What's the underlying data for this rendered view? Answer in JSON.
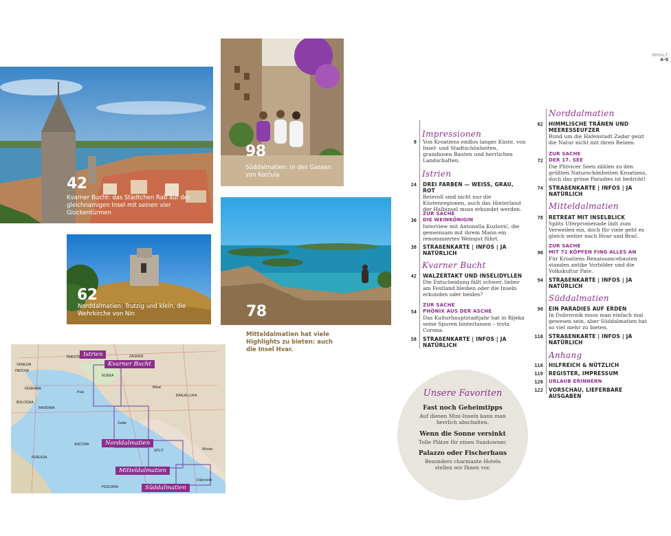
{
  "header": {
    "section": "INHALT",
    "pages": "4–5"
  },
  "photos": [
    {
      "number": "42",
      "caption": "Kvarner Bucht: das Städtchen Rab auf der gleichnamigen Insel mit seinen vier Glockentürmen"
    },
    {
      "number": "98",
      "caption": "Süddalmatien: in den Gassen von Korčula"
    },
    {
      "number": "62",
      "caption": "Norddalmatien: Trutzig und klein, die Wehrkirche von Nin"
    },
    {
      "number": "78",
      "caption": "Mitteldalmatien hat viele Highlights zu bieten: auch die Insel Hvar."
    }
  ],
  "toc_left": {
    "impressionen": {
      "heading": "Impressionen",
      "page": "8",
      "body": "Von Kroatiens endlos langer Küste, von Insel- und Stadtschönheiten, grandiosen Bauten und herrlichen Landschaften."
    },
    "istrien": {
      "heading": "Istrien",
      "e1": {
        "page": "24",
        "title": "DREI FARBEN — WEISS, GRAU, ROT",
        "body": "Reizvoll sind nicht nur die Küstenregionen, auch das Hinterland der Halbinsel muss erkundet werden."
      },
      "e2": {
        "page": "36",
        "series": "ZUR SACHE",
        "title": "DIE WEINKÖNIGIN",
        "body": "Interview mit Antonella Kozlović, die gemeinsam mit ihrem Mann ein renommiertes Weingut führt."
      },
      "e3": {
        "page": "38",
        "title": "STRAßENKARTE | INFOS | JA NATÜRLICH"
      }
    },
    "kvarner": {
      "heading": "Kvarner Bucht",
      "e1": {
        "page": "42",
        "title": "WALZERTAKT UND INSELIDYLLEN",
        "body": "Die Entscheidung fällt schwer, lieber am Festland bleiben oder die Inseln erkunden oder beides?"
      },
      "e2": {
        "page": "54",
        "series": "ZUR SACHE",
        "title": "PHÖNIX AUS DER ASCHE",
        "body": "Das Kulturhauptstadtjahr hat in Rijeka seine Spuren hinterlassen – trotz Corona."
      },
      "e3": {
        "page": "58",
        "title": "STRAßENKARTE | INFOS | JA NATÜRLICH"
      }
    }
  },
  "toc_right": {
    "norddalmatien": {
      "heading": "Norddalmatien",
      "e1": {
        "page": "62",
        "title": "HIMMLISCHE TRÄNEN UND MEERESSEUFZER",
        "body": "Rund um die Hafenstadt Zadar geizt die Natur nicht mit ihren Reizen."
      },
      "e2": {
        "page": "72",
        "series": "ZUR SACHE",
        "title": "DER 17. SEE",
        "body": "Die Plitvicer Seen zählen zu den größten Naturschönheiten Kroatiens, doch das grüne Paradies ist bedroht!"
      },
      "e3": {
        "page": "74",
        "title": "STRAßENKARTE | INFOS | JA NATÜRLICH"
      }
    },
    "mitteldalmatien": {
      "heading": "Mitteldalmatien",
      "e1": {
        "page": "78",
        "title": "RETREAT MIT INSELBLICK",
        "body": "Splits Uferpromenade lädt zum Verweilen ein, doch für viele geht es gleich weiter nach Hvar und Brač."
      },
      "e2": {
        "page": "90",
        "series": "ZUR SACHE",
        "title": "MIT 72 KÖPFEN FING ALLES AN",
        "body": "Für Kroatiens Renaissancebauten standen antike Vorbilder und die Volkskultur Pate."
      },
      "e3": {
        "page": "94",
        "title": "STRAßENKARTE | INFOS | JA NATÜRLICH"
      }
    },
    "sueddalmatien": {
      "heading": "Süddalmatien",
      "e1": {
        "page": "98",
        "title": "EIN PARADIES AUF ERDEN",
        "body": "In Dubrovnik muss man einfach mal gewesen sein, aber Süddalmatien hat so viel mehr zu bieten."
      },
      "e2": {
        "page": "110",
        "title": "STRAßENKARTE | INFOS | JA NATÜRLICH"
      }
    },
    "anhang": {
      "heading": "Anhang",
      "e1": {
        "page": "116",
        "title": "HILFREICH & NÜTZLICH"
      },
      "e2": {
        "page": "119",
        "title": "REGISTER, IMPRESSUM"
      },
      "e3": {
        "page": "120",
        "title": "URLAUB ERINNERN"
      },
      "e4": {
        "page": "122",
        "title": "VORSCHAU, LIEFERBARE AUSGABEN"
      }
    }
  },
  "favorites": {
    "heading": "Unsere Favoriten",
    "f1": {
      "title": "Fast noch Geheimtipps",
      "body": "Auf diesen Mini-Inseln kann man herrlich abschalten."
    },
    "f2": {
      "title": "Wenn die Sonne versinkt",
      "body": "Tolle Plätze für einen Sundowner."
    },
    "f3": {
      "title": "Palazzo oder Fischerhaus",
      "body": "Besonders charmante Hotels stellen wir Ihnen vor."
    }
  },
  "map": {
    "regions": {
      "istrien": "Istrien",
      "kvarner": "Kvarner Bucht",
      "nord": "Norddalmatien",
      "mittel": "Mitteldalmatien",
      "sued": "Süddalmatien"
    },
    "places": {
      "trieste": "TRIESTE",
      "zagreb": "ZAGREB",
      "rijeka": "RIJEKA",
      "venezia": "VENEZIA",
      "padova": "PADOVA",
      "pula": "Pula",
      "bologna": "BOLOGNA",
      "ravenna": "RAVENNA",
      "zadar": "Zadar",
      "split": "SPLIT",
      "ancona": "ANCONA",
      "pescara": "PESCARA",
      "bihac": "Bihać",
      "banja_luka": "BANJA LUKA",
      "mostar": "Mostar",
      "dubrovnik": "Dubrovnik",
      "perugia": "PERUGIA",
      "ferrara": "FERRARA"
    }
  }
}
